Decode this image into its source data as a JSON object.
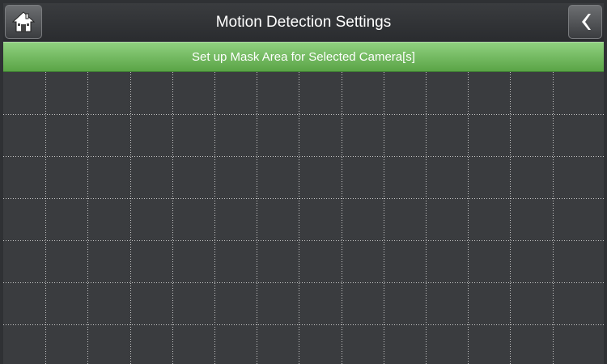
{
  "header": {
    "title": "Motion Detection Settings",
    "home_icon": "home-icon",
    "back_icon": "chevron-left-icon"
  },
  "banner": {
    "text": "Set up Mask Area for Selected Camera[s]"
  },
  "mask_grid": {
    "columns": 14,
    "rows": 7
  },
  "colors": {
    "banner_green": "#6cb85a",
    "grid_background": "#3a3c3f",
    "grid_line": "#c8c8c8"
  }
}
